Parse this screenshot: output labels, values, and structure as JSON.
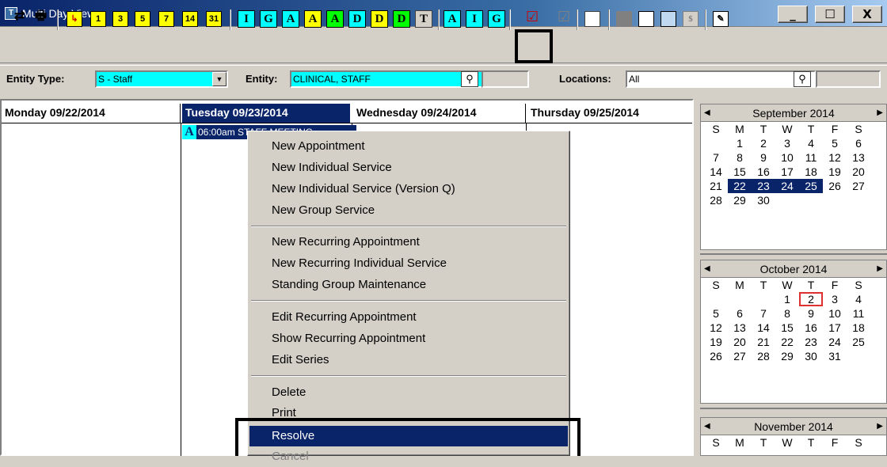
{
  "window": {
    "title": "Multi Day View",
    "min": "_",
    "max": "☐",
    "close": "X"
  },
  "toolbar": {
    "refresh": "⇄",
    "print": "🖶",
    "day_buttons": [
      "1",
      "3",
      "5",
      "7",
      "14",
      "31"
    ],
    "letters1": [
      "I",
      "G",
      "A",
      "A",
      "A",
      "D",
      "D",
      "D",
      "T"
    ],
    "letters2": [
      "A",
      "I",
      "G"
    ],
    "check": "☑",
    "check2": "☑"
  },
  "filter": {
    "entity_type_label": "Entity Type:",
    "entity_type_value": "S - Staff",
    "entity_label": "Entity:",
    "entity_value": "CLINICAL, STAFF",
    "locations_label": "Locations:",
    "locations_value": "All"
  },
  "days": [
    "Monday 09/22/2014",
    "Tuesday 09/23/2014",
    "Wednesday 09/24/2014",
    "Thursday 09/25/2014"
  ],
  "appointment": {
    "badge": "A",
    "text": "06:00am STAFF MEETING"
  },
  "menu": {
    "items": [
      "New Appointment",
      "New Individual Service",
      "New Individual Service (Version Q)",
      "New Group Service",
      "New Recurring Appointment",
      "New Recurring Individual Service",
      "Standing Group Maintenance",
      "Edit Recurring Appointment",
      "Show Recurring Appointment",
      "Edit Series",
      "Delete",
      "Print",
      "Resolve",
      "Cancel"
    ]
  },
  "calendars": [
    {
      "title": "September 2014",
      "dow": [
        "S",
        "M",
        "T",
        "W",
        "T",
        "F",
        "S"
      ],
      "weeks": [
        [
          "",
          "1",
          "2",
          "3",
          "4",
          "5",
          "6"
        ],
        [
          "7",
          "8",
          "9",
          "10",
          "11",
          "12",
          "13"
        ],
        [
          "14",
          "15",
          "16",
          "17",
          "18",
          "19",
          "20"
        ],
        [
          "21",
          "22",
          "23",
          "24",
          "25",
          "26",
          "27"
        ],
        [
          "28",
          "29",
          "30",
          "",
          "",
          "",
          ""
        ]
      ]
    },
    {
      "title": "October 2014",
      "dow": [
        "S",
        "M",
        "T",
        "W",
        "T",
        "F",
        "S"
      ],
      "weeks": [
        [
          "",
          "",
          "",
          "1",
          "2",
          "3",
          "4"
        ],
        [
          "5",
          "6",
          "7",
          "8",
          "9",
          "10",
          "11"
        ],
        [
          "12",
          "13",
          "14",
          "15",
          "16",
          "17",
          "18"
        ],
        [
          "19",
          "20",
          "21",
          "22",
          "23",
          "24",
          "25"
        ],
        [
          "26",
          "27",
          "28",
          "29",
          "30",
          "31",
          ""
        ]
      ]
    },
    {
      "title": "November 2014",
      "dow": [
        "S",
        "M",
        "T",
        "W",
        "T",
        "F",
        "S"
      ]
    }
  ]
}
